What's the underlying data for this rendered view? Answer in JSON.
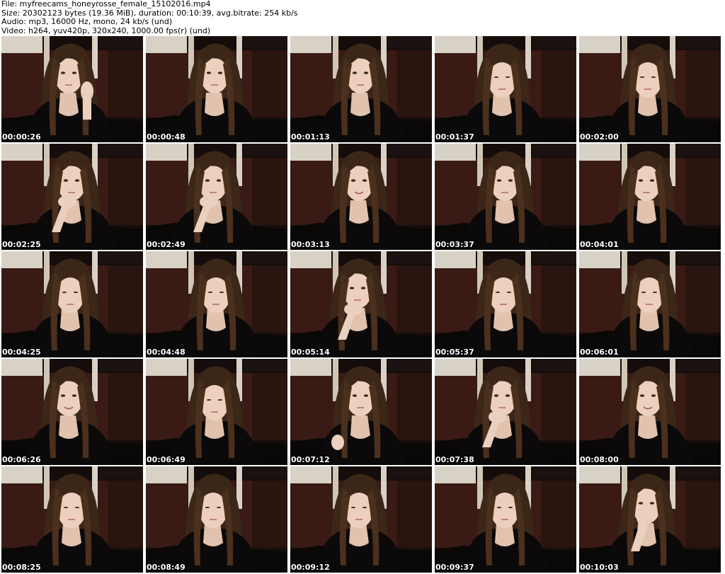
{
  "header": {
    "file_line": "File: myfreecams_honeyrosse_female_15102016.mp4",
    "size_line": "Size: 20302123 bytes (19.36 MiB), duration: 00:10:39, avg.bitrate: 254 kb/s",
    "audio_line": "Audio: mp3, 16000 Hz, mono, 24 kb/s (und)",
    "video_line": "Video: h264, yuv420p, 320x240, 1000.00 fps(r) (und)"
  },
  "frames": [
    {
      "timestamp": "00:00:26",
      "pose": "hand-cheek"
    },
    {
      "timestamp": "00:00:48",
      "pose": "neutral"
    },
    {
      "timestamp": "00:01:13",
      "pose": "neutral"
    },
    {
      "timestamp": "00:01:37",
      "pose": "looking-down"
    },
    {
      "timestamp": "00:02:00",
      "pose": "looking-down"
    },
    {
      "timestamp": "00:02:25",
      "pose": "hand-chin"
    },
    {
      "timestamp": "00:02:49",
      "pose": "hand-chin"
    },
    {
      "timestamp": "00:03:13",
      "pose": "smiling"
    },
    {
      "timestamp": "00:03:37",
      "pose": "neutral"
    },
    {
      "timestamp": "00:04:01",
      "pose": "neutral"
    },
    {
      "timestamp": "00:04:25",
      "pose": "looking-down"
    },
    {
      "timestamp": "00:04:48",
      "pose": "looking-down"
    },
    {
      "timestamp": "00:05:14",
      "pose": "hand-chin"
    },
    {
      "timestamp": "00:05:37",
      "pose": "looking-down"
    },
    {
      "timestamp": "00:06:01",
      "pose": "looking-down"
    },
    {
      "timestamp": "00:06:26",
      "pose": "smiling"
    },
    {
      "timestamp": "00:06:49",
      "pose": "looking-down"
    },
    {
      "timestamp": "00:07:12",
      "pose": "hand-hair"
    },
    {
      "timestamp": "00:07:38",
      "pose": "hand-chin"
    },
    {
      "timestamp": "00:08:00",
      "pose": "smiling"
    },
    {
      "timestamp": "00:08:25",
      "pose": "looking-down"
    },
    {
      "timestamp": "00:08:49",
      "pose": "looking-down"
    },
    {
      "timestamp": "00:09:12",
      "pose": "looking-down"
    },
    {
      "timestamp": "00:09:37",
      "pose": "looking-down"
    },
    {
      "timestamp": "00:10:03",
      "pose": "hand-mouth"
    }
  ]
}
